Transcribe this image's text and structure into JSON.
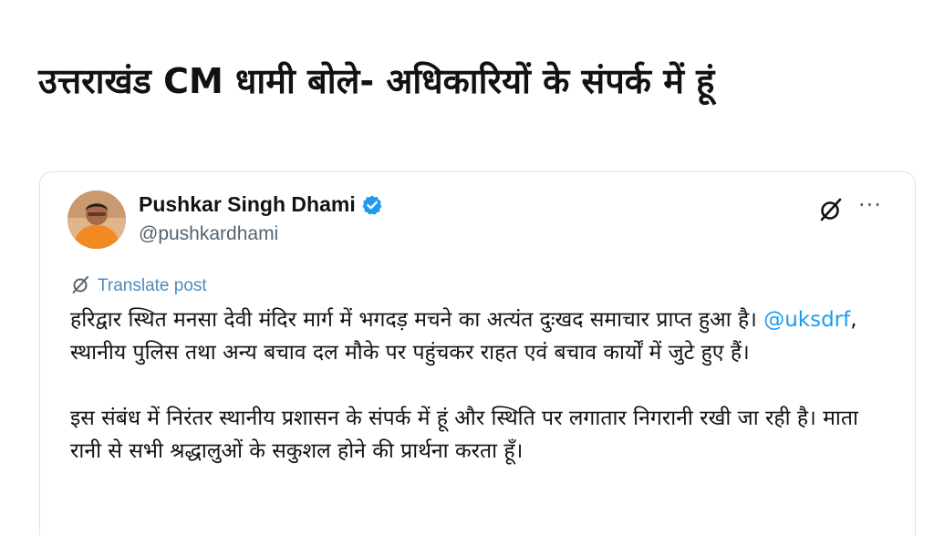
{
  "headline": "उत्तराखंड CM धामी बोले- अधिकारियों के संपर्क में हूं",
  "tweet": {
    "author": {
      "display_name": "Pushkar Singh Dhami",
      "handle": "@pushkardhami",
      "verified": true
    },
    "translate_label": "Translate post",
    "paragraph1_before": "हरिद्वार स्थित मनसा देवी मंदिर मार्ग में भगदड़ मचने का अत्यंत दुःखद समाचार प्राप्त हुआ है। ",
    "mention": "@uksdrf",
    "paragraph1_after": ", स्थानीय पुलिस तथा अन्य बचाव दल मौके पर पहुंचकर राहत एवं बचाव कार्यों में जुटे हुए हैं।",
    "paragraph2": "इस संबंध में निरंतर स्थानीय प्रशासन के संपर्क में हूं और स्थिति पर लगातार निगरानी रखी जा रही है। माता रानी से सभी श्रद्धालुओं के सकुशल होने की प्रार्थना करता हूँ।"
  },
  "icons": {
    "verified": "verified-badge-icon",
    "grok": "grok-icon",
    "more": "more-icon",
    "translate": "translate-icon"
  },
  "colors": {
    "verified_blue": "#1d9bf0",
    "link": "#1d9bf0",
    "translate": "#4d8bbf",
    "handle_gray": "#536471"
  }
}
